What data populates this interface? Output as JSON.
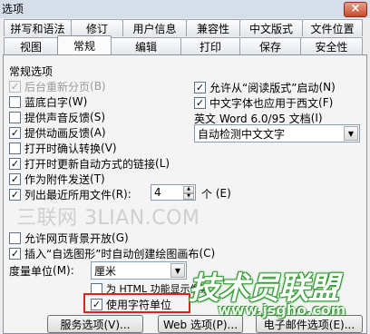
{
  "window": {
    "title": "选项",
    "close_glyph": "×"
  },
  "tabs_row1": [
    "拼写和语法",
    "修订",
    "用户信息",
    "兼容性",
    "中文版式",
    "文件位置"
  ],
  "tabs_row2": [
    "视图",
    "常规",
    "编辑",
    "打印",
    "保存",
    "安全性"
  ],
  "active_tab": "常规",
  "section_title": "常规选项",
  "left_options": [
    {
      "label": "后台重新分页",
      "key": "(B)",
      "checked": true,
      "disabled": true
    },
    {
      "label": "蓝底白字",
      "key": "(W)",
      "checked": false,
      "disabled": false
    },
    {
      "label": "提供声音反馈",
      "key": "(S)",
      "checked": false,
      "disabled": false
    },
    {
      "label": "提供动画反馈",
      "key": "(A)",
      "checked": true,
      "disabled": false
    },
    {
      "label": "打开时确认转换",
      "key": "(V)",
      "checked": false,
      "disabled": false
    },
    {
      "label": "打开时更新自动方式的链接",
      "key": "(L)",
      "checked": true,
      "disabled": false
    },
    {
      "label": "作为附件发送",
      "key": "(T)",
      "checked": true,
      "disabled": false
    },
    {
      "label": "列出最近所用文件",
      "key": "(R):",
      "checked": true,
      "disabled": false
    }
  ],
  "recent_files": {
    "count": "4",
    "unit": "个",
    "unit_key": "(E)"
  },
  "right_options": [
    {
      "label": "允许从“阅读版式”启动",
      "key": "(N)",
      "checked": true
    },
    {
      "label": "中文字体也应用于西文",
      "key": "(F)",
      "checked": true
    }
  ],
  "word_version": {
    "label": "英文 Word 6.0/95 文档",
    "key": "(I)",
    "value": "自动检测中文文字"
  },
  "watermark_text": "三联网 3LIAN.COM",
  "bottom_options": [
    {
      "label": "允许网页背景开放",
      "key": "(G)",
      "checked": false
    },
    {
      "label": "插入“自选图形”时自动创建绘图画布",
      "key": "(C)",
      "checked": true
    }
  ],
  "measure_unit": {
    "label": "度量单位",
    "key": "(M):",
    "value": "厘米"
  },
  "sub_options": [
    {
      "label": "为 HTML 功能显示像素",
      "checked": false
    },
    {
      "label": "使用字符单位",
      "checked": true
    }
  ],
  "buttons": {
    "service": "服务选项(V)...",
    "web": "Web 选项(P)...",
    "email": "电子邮件选项(E)..."
  },
  "logo": {
    "text": "技术员联盟",
    "url": "www.jsgho.com"
  },
  "colors": {
    "highlight_box": "#e02020",
    "logo_green": "#2d8f2d"
  },
  "icons": [
    "close-icon",
    "checkmark-icon",
    "dropdown-arrow-icon",
    "spin-up-icon",
    "spin-down-icon"
  ]
}
